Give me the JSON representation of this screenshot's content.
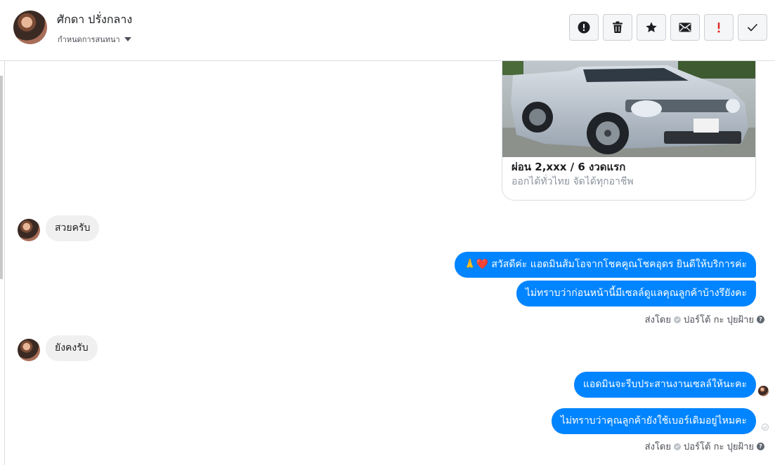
{
  "header": {
    "name": "ศักดา ปรั่งกลาง",
    "assign_label": "กำหนดการสนทนา",
    "toolbar": [
      {
        "name": "report-spam-button",
        "icon": "exclamation-circle-icon"
      },
      {
        "name": "delete-button",
        "icon": "trash-icon"
      },
      {
        "name": "star-button",
        "icon": "star-icon"
      },
      {
        "name": "mark-unread-button",
        "icon": "envelope-icon"
      },
      {
        "name": "follow-up-button",
        "icon": "exclamation-icon",
        "color": "#e02424"
      },
      {
        "name": "mark-done-button",
        "icon": "check-icon"
      }
    ]
  },
  "card": {
    "title": "ผ่อน 2,xxx / 6 งวดแรก",
    "subtitle": "ออกได้ทั่วไทย จัดได้ทุกอาชีพ"
  },
  "messages": {
    "incoming_1": "สวยครับ",
    "outgoing_1": "🙏❤️ สวัสดีค่ะ แอดมินส้มโอจากโชคคูณโชคอุดร ยินดีให้บริการค่ะ",
    "outgoing_2": "ไม่ทราบว่าก่อนหน้านี้มีเซลล์ดูแลคุณลูกค้าบ้างรึยังคะ",
    "incoming_2": "ยังคงรับ",
    "outgoing_3": "แอดมินจะรีบประสานงานเซลล์ให้นะคะ",
    "outgoing_4": "ไม่ทราบว่าคุณลูกค้ายังใช้เบอร์เดิมอยู่ไหมคะ"
  },
  "sent_by": {
    "prefix": "ส่งโดย",
    "name": "ปอร์โต้ กะ ปุยฝ้าย"
  },
  "colors": {
    "outgoing_bubble": "#0084ff",
    "incoming_bubble": "#f1f0f0",
    "follow_up_flag": "#e02424"
  }
}
